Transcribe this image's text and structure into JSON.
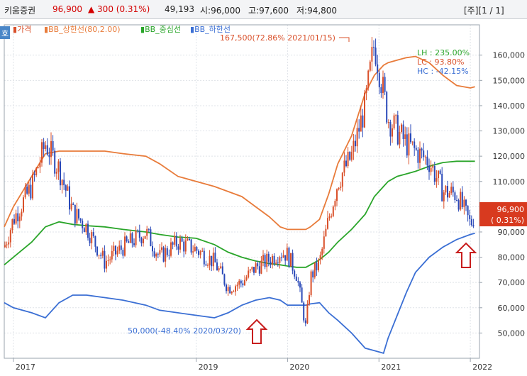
{
  "header": {
    "stock_name": "키움증권",
    "price": "96,900",
    "change": "▲ 300 (0.31%)",
    "volume": "49,193",
    "open": "시:96,000",
    "high": "고:97,600",
    "low": "저:94,800",
    "page_indicator": "[주][1 / 1]"
  },
  "toolbar": {
    "ho_label": "호"
  },
  "legend": {
    "price": "가격",
    "upper": "BB_상한선(80,2.00)",
    "middle": "BB_중심선",
    "lower": "BB_하한선"
  },
  "stats": {
    "lh": "LH  : 235.00%",
    "lc": "LC  : 93.80%",
    "hc": "HC  : -42.15%"
  },
  "annotations": {
    "high_label": "167,500(72.86% 2021/01/15)",
    "low_label": "50,000(-48.40% 2020/03/20)",
    "current_price": "96,900",
    "current_pct": "( 0.31%)"
  },
  "colors": {
    "upper": "#e87b3a",
    "middle": "#2aa52a",
    "lower": "#3b6fd4",
    "up_candle": "#d9502a",
    "down_candle": "#2a49b8",
    "arrow": "#c81e1e",
    "badge": "#d83a1f"
  },
  "chart_data": {
    "type": "line",
    "title": "",
    "xlabel": "",
    "ylabel": "",
    "x_ticks": [
      "2017",
      "2019",
      "2020",
      "2021",
      "2022"
    ],
    "y_ticks": [
      "50,000",
      "60,000",
      "70,000",
      "80,000",
      "90,000",
      "100,000",
      "110,000",
      "120,000",
      "130,000",
      "140,000",
      "150,000",
      "160,000"
    ],
    "ylim": [
      40000,
      172000
    ],
    "grid": true,
    "legend_position": "top-left",
    "x_years": [
      2016.9,
      2017.0,
      2017.2,
      2017.35,
      2017.5,
      2017.65,
      2017.8,
      2018.0,
      2018.2,
      2018.45,
      2018.6,
      2018.8,
      2019.0,
      2019.2,
      2019.35,
      2019.5,
      2019.65,
      2019.8,
      2019.92,
      2020.0,
      2020.1,
      2020.2,
      2020.25,
      2020.35,
      2020.45,
      2020.55,
      2020.7,
      2020.85,
      2020.95,
      2021.05,
      2021.1,
      2021.2,
      2021.3,
      2021.4,
      2021.55,
      2021.7,
      2021.85,
      2022.0,
      2022.05
    ],
    "series": [
      {
        "name": "가격",
        "values": [
          84000,
          95000,
          108000,
          125000,
          115000,
          98000,
          92000,
          78000,
          84000,
          90000,
          80000,
          86000,
          83000,
          78000,
          68000,
          70000,
          76000,
          79000,
          82000,
          81000,
          73000,
          52000,
          72000,
          78000,
          95000,
          110000,
          120000,
          140000,
          165000,
          145000,
          135000,
          130000,
          125000,
          122000,
          118000,
          106000,
          105000,
          93000,
          96900
        ]
      },
      {
        "name": "BB_상한선(80,2.00)",
        "values": [
          92000,
          100000,
          112000,
          121000,
          122000,
          122000,
          122000,
          122000,
          121000,
          120000,
          117000,
          112000,
          110000,
          108000,
          106000,
          104000,
          100000,
          96000,
          92000,
          91000,
          91000,
          91000,
          92000,
          95000,
          105000,
          117000,
          128000,
          145000,
          152000,
          156000,
          157000,
          158000,
          159000,
          159500,
          157000,
          152000,
          148000,
          147000,
          147500
        ]
      },
      {
        "name": "BB_중심선",
        "values": [
          77000,
          80000,
          86000,
          92000,
          94000,
          93000,
          92500,
          92000,
          91000,
          90000,
          89000,
          88000,
          87500,
          85000,
          82000,
          80000,
          78500,
          77500,
          77000,
          76500,
          76000,
          76000,
          77000,
          79000,
          82000,
          86000,
          91000,
          97000,
          104000,
          108000,
          110000,
          112000,
          113000,
          114000,
          116000,
          117500,
          118000,
          118000,
          118000
        ]
      },
      {
        "name": "BB_하한선",
        "values": [
          62000,
          60000,
          58000,
          56000,
          62000,
          65000,
          65000,
          64000,
          63000,
          61000,
          59000,
          58000,
          57000,
          56000,
          58000,
          61000,
          63000,
          64000,
          63000,
          61000,
          61000,
          61000,
          61500,
          62000,
          58000,
          55000,
          50000,
          44000,
          43000,
          42000,
          48000,
          57000,
          66000,
          74000,
          80000,
          84000,
          87000,
          89000,
          89500
        ]
      }
    ]
  }
}
